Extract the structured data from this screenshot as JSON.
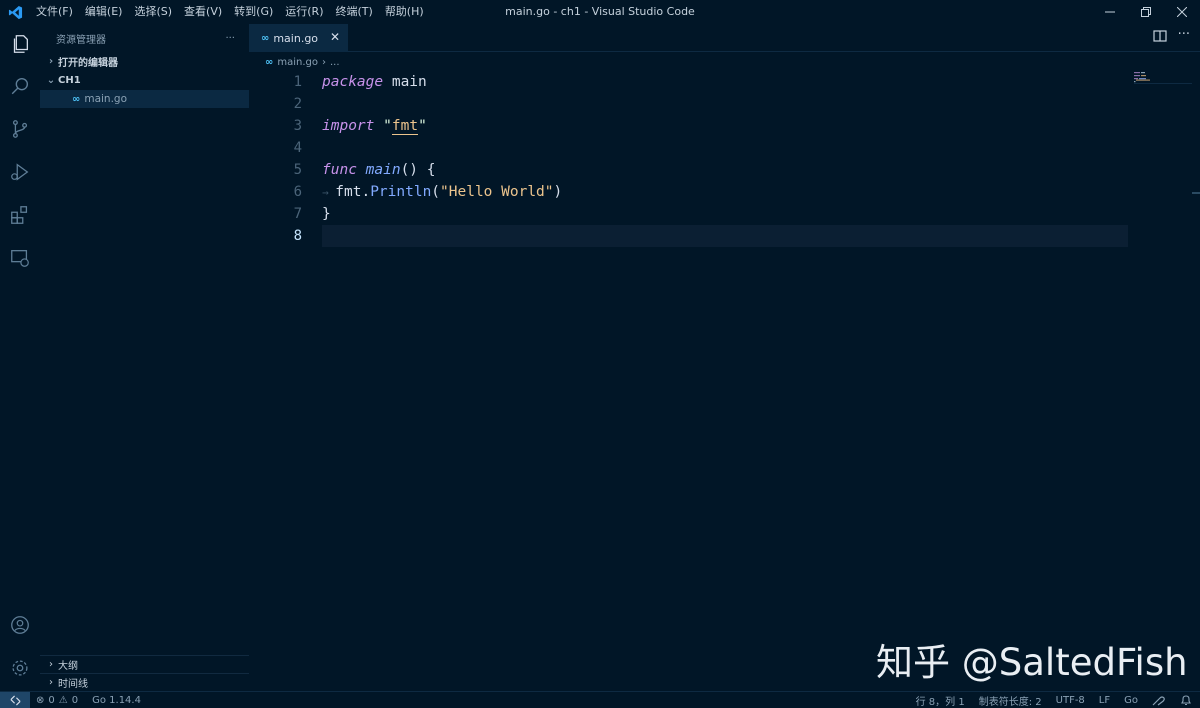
{
  "menu": [
    "文件(F)",
    "编辑(E)",
    "选择(S)",
    "查看(V)",
    "转到(G)",
    "运行(R)",
    "终端(T)",
    "帮助(H)"
  ],
  "window_title": "main.go - ch1 - Visual Studio Code",
  "sidebar": {
    "title": "资源管理器",
    "more": "···",
    "open_editors": "打开的编辑器",
    "folder": "CH1",
    "file": "main.go",
    "outline": "大纲",
    "timeline": "时间线"
  },
  "tab": {
    "label": "main.go",
    "close": "✕"
  },
  "breadcrumb": {
    "file": "main.go",
    "sep": "›",
    "more": "..."
  },
  "editor": {
    "line_numbers": [
      "1",
      "2",
      "3",
      "4",
      "5",
      "6",
      "7",
      "8"
    ],
    "code": {
      "l1_kw": "package",
      "l1_rest": " main",
      "l3_kw": "import",
      "l3_q1": "\"",
      "l3_str": "fmt",
      "l3_q2": "\"",
      "l5_kw": "func",
      "l5_fn": "main",
      "l5_rest": "() {",
      "l6_obj": "fmt",
      "l6_dot": ".",
      "l6_meth": "Println",
      "l6_open": "(",
      "l6_str": "\"Hello World\"",
      "l6_close": ")",
      "l7": "}"
    }
  },
  "status": {
    "errors": "0",
    "warnings": "0",
    "go_version": "Go 1.14.4",
    "position": "行 8，列 1",
    "tab_size": "制表符长度: 2",
    "encoding": "UTF-8",
    "eol": "LF",
    "language": "Go"
  },
  "watermark": "知乎 @SaltedFish",
  "colors": {
    "background": "#011627",
    "keyword": "#c792ea",
    "function": "#82aaff",
    "string": "#ecc48d",
    "text": "#d6deeb"
  }
}
